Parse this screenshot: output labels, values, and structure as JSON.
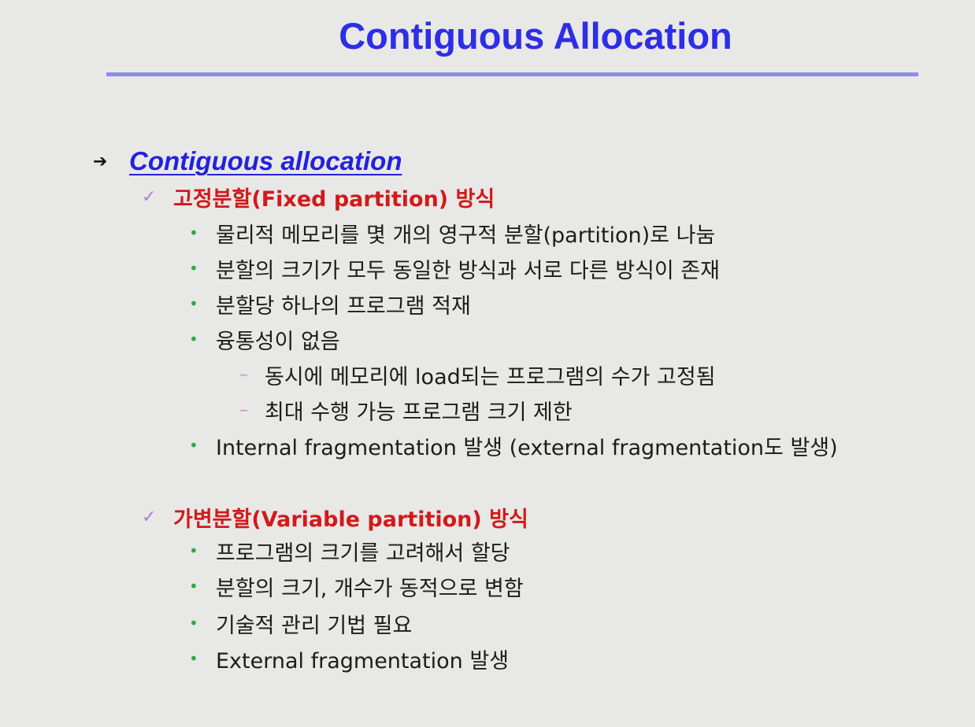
{
  "slide": {
    "title": "Contiguous Allocation",
    "heading": "Contiguous allocation",
    "sections": [
      {
        "label": "고정분할(Fixed partition) 방식",
        "bullets": [
          "물리적 메모리를 몇 개의 영구적 분할(partition)로 나눔",
          "분할의 크기가 모두 동일한 방식과 서로 다른 방식이 존재",
          "분할당 하나의 프로그램 적재",
          "융통성이 없음"
        ],
        "sub_bullets": [
          "동시에 메모리에 load되는 프로그램의 수가 고정됨",
          "최대 수행 가능 프로그램 크기 제한"
        ],
        "last_bullet": "Internal fragmentation 발생 (external fragmentation도 발생)"
      },
      {
        "label": "가변분할(Variable partition) 방식",
        "bullets": [
          "프로그램의 크기를 고려해서 할당",
          "분할의 크기, 개수가 동적으로 변함",
          "기술적 관리 기법 필요",
          "External fragmentation 발생"
        ]
      }
    ]
  },
  "icons": {
    "heading_marker": "arrow-right-icon",
    "section_marker": "checkmark-icon",
    "bullet_marker": "bullet-dot-icon",
    "sub_bullet_marker": "dash-icon"
  },
  "colors": {
    "title": "#2e2ee6",
    "title_rule": "#8c8cf2",
    "heading": "#2222dd",
    "section_label": "#d11a1a",
    "checkmark": "#b07cd6",
    "bullet": "#2eaa44",
    "dash": "#d88cc0",
    "background": "#e8e8e6"
  }
}
